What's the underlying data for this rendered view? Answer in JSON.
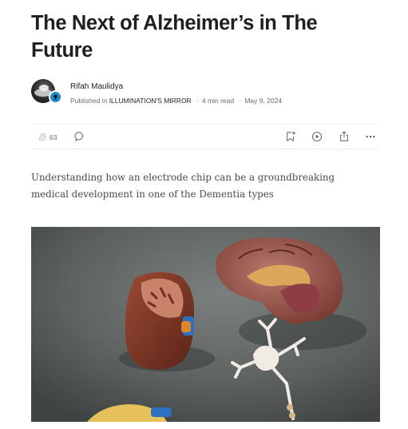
{
  "article": {
    "title": "The Next of Alzheimer’s in The Future",
    "subtitle": "Understanding how an electrode chip can be a groundbreaking medical development in one of the Dementia types"
  },
  "byline": {
    "author": "Rifah Maulidya",
    "published_prefix": "Published in",
    "publication": "ILLUMINATION'S MIRROR",
    "separator": "·",
    "read_time": "4 min read",
    "date": "May 9, 2024"
  },
  "actions": {
    "clap_count": "63",
    "icons": [
      "clap-icon",
      "comment-icon",
      "bookmark-add-icon",
      "play-listen-icon",
      "share-icon",
      "more-icon"
    ]
  },
  "colors": {
    "text": "#242424",
    "muted": "#6b6b6b",
    "badge": "#1a8ac9",
    "photo_bg": "#5a5f5e"
  }
}
